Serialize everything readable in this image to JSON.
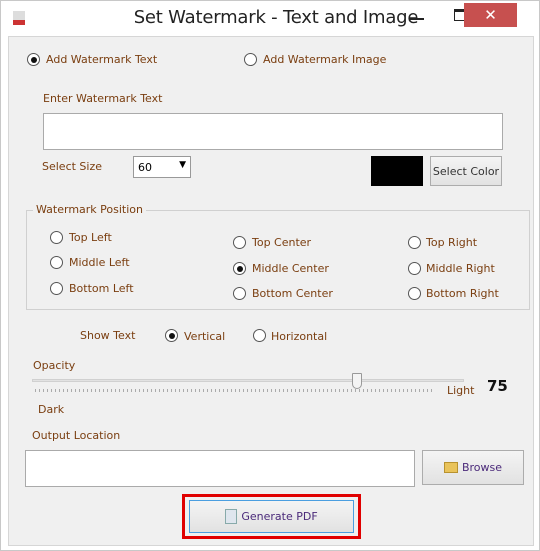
{
  "window": {
    "title": "Set Watermark  - Text and Image"
  },
  "mode": {
    "text_label": "Add Watermark Text",
    "image_label": "Add Watermark Image",
    "selected": "text"
  },
  "watermark_text": {
    "label": "Enter Watermark Text",
    "value": ""
  },
  "size": {
    "label": "Select Size",
    "value": "60"
  },
  "color": {
    "swatch": "#000000",
    "button_label": "Select Color"
  },
  "position": {
    "legend": "Watermark Position",
    "options": [
      "Top Left",
      "Top Center",
      "Top Right",
      "Middle Left",
      "Middle Center",
      "Middle Right",
      "Bottom Left",
      "Bottom Center",
      "Bottom Right"
    ],
    "selected": "Middle Center"
  },
  "show_text": {
    "label": "Show Text",
    "vertical": "Vertical",
    "horizontal": "Horizontal",
    "selected": "Vertical"
  },
  "opacity": {
    "label": "Opacity",
    "min_label": "Dark",
    "max_label": "Light",
    "value": "75"
  },
  "output": {
    "label": "Output Location",
    "value": "",
    "browse_label": "Browse"
  },
  "generate": {
    "label": "Generate PDF",
    "highlight": "#e00000"
  },
  "accent": {
    "text": "#7a3e10",
    "close": "#c7504f"
  }
}
